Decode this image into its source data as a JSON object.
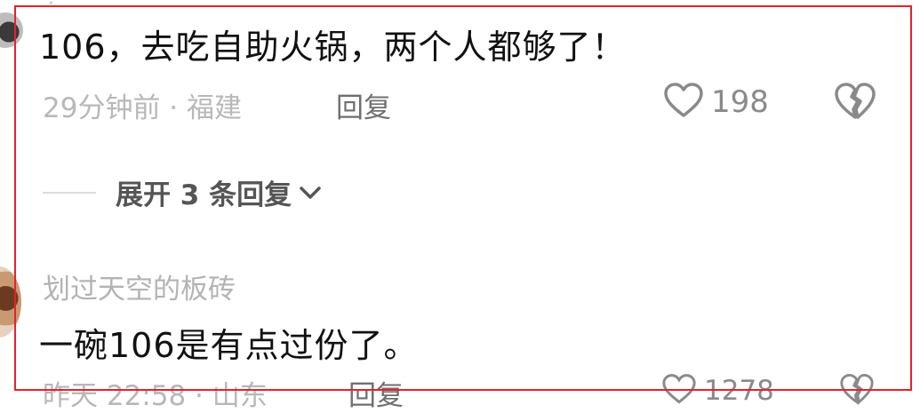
{
  "comments": [
    {
      "text": "106，去吃自助火锅，两个人都够了！",
      "meta": "29分钟前 · 福建",
      "reply_label": "回复",
      "like_count": "198",
      "expand_label": "展开 3 条回复"
    },
    {
      "username": "划过天空的板砖",
      "text": "一碗106是有点过份了。",
      "meta": "昨天 22:58 · 山东",
      "reply_label": "回复",
      "like_count": "1278"
    }
  ],
  "icons": {
    "like": "heart-outline-icon",
    "dislike": "broken-heart-icon",
    "expand": "chevron-down-icon"
  },
  "colors": {
    "highlight_border": "#e8212b",
    "text_primary": "#111111",
    "text_muted": "#b8b8b8"
  }
}
